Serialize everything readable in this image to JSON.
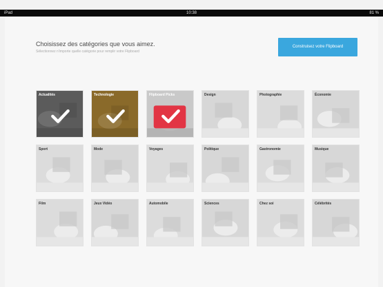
{
  "status_bar": {
    "carrier": "iPad",
    "time": "10:38",
    "battery": "81 %"
  },
  "header": {
    "title": "Choisissez des catégories que vous aimez.",
    "subtitle": "Sélectionnez n'importe quelle catégorie pour remplir votre Flipboard",
    "build_button": "Construisez votre Flipboard"
  },
  "colors": {
    "accent": "#3aa7de",
    "selected_red": "#e23544",
    "tile_bg": "#d9d9d9"
  },
  "categories": [
    {
      "label": "Actualités",
      "selected": true,
      "icon": "newspaper-icon"
    },
    {
      "label": "Technologie",
      "selected": true,
      "icon": "circuit-icon"
    },
    {
      "label": "Flipboard Picks",
      "selected": true,
      "icon": "flipboard-icon"
    },
    {
      "label": "Design",
      "selected": false,
      "icon": "design-icon"
    },
    {
      "label": "Photographie",
      "selected": false,
      "icon": "camera-icon"
    },
    {
      "label": "Économie",
      "selected": false,
      "icon": "economy-icon"
    },
    {
      "label": "Sport",
      "selected": false,
      "icon": "soccer-ball-icon"
    },
    {
      "label": "Mode",
      "selected": false,
      "icon": "fashion-icon"
    },
    {
      "label": "Voyages",
      "selected": false,
      "icon": "airplane-icon"
    },
    {
      "label": "Politique",
      "selected": false,
      "icon": "columns-icon"
    },
    {
      "label": "Gastronomie",
      "selected": false,
      "icon": "food-icon"
    },
    {
      "label": "Musique",
      "selected": false,
      "icon": "music-icon"
    },
    {
      "label": "Film",
      "selected": false,
      "icon": "screen-icon"
    },
    {
      "label": "Jeux Vidéo",
      "selected": false,
      "icon": "gamepad-icon"
    },
    {
      "label": "Automobile",
      "selected": false,
      "icon": "car-icon"
    },
    {
      "label": "Sciences",
      "selected": false,
      "icon": "science-icon"
    },
    {
      "label": "Chez soi",
      "selected": false,
      "icon": "home-icon"
    },
    {
      "label": "Célébrités",
      "selected": false,
      "icon": "celebrity-icon"
    }
  ]
}
